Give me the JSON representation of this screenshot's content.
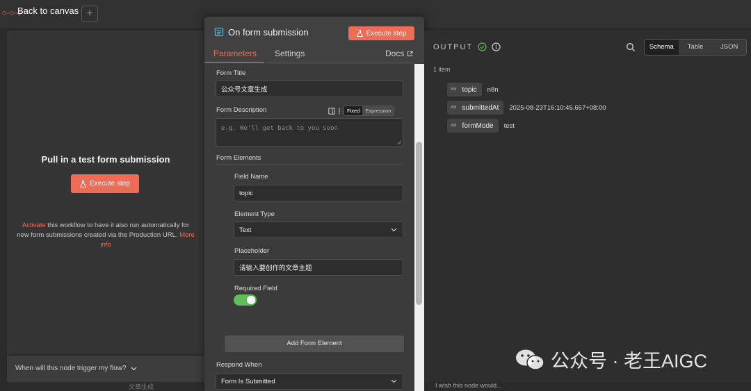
{
  "topbar": {
    "back_label": "Back to canvas",
    "add_label": "+"
  },
  "left_panel": {
    "title": "Pull in a test form submission",
    "execute_label": "Execute step",
    "desc_link_activate": "Activate",
    "desc_middle": " this workflow to have it also run automatically for new form submissions created via the Production URL. ",
    "desc_link_more": "More info",
    "footer_label": "When will this node trigger my flow?",
    "bottom_strip": "文章生成"
  },
  "node": {
    "title": "On form submission",
    "execute_label": "Execute step",
    "tabs": {
      "parameters": "Parameters",
      "settings": "Settings",
      "docs": "Docs"
    },
    "form_title_label": "Form Title",
    "form_title_value": "公众号文章生成",
    "form_desc_label": "Form Description",
    "form_desc_placeholder": "e.g. We'll get back to you soon",
    "mode_fixed": "Fixed",
    "mode_expression": "Expression",
    "form_elements_label": "Form Elements",
    "field_name_label": "Field Name",
    "field_name_value": "topic",
    "element_type_label": "Element Type",
    "element_type_value": "Text",
    "placeholder_label": "Placeholder",
    "placeholder_value": "请输入要创作的文章主题",
    "required_label": "Required Field",
    "required_on": true,
    "add_element_label": "Add Form Element",
    "respond_when_label": "Respond When",
    "respond_when_value": "Form Is Submitted"
  },
  "output": {
    "title": "OUTPUT",
    "views": [
      "Schema",
      "Table",
      "JSON"
    ],
    "active_view": "Schema",
    "item_count": "1 item",
    "fields": [
      {
        "type": "AB",
        "key": "topic",
        "value": "n8n"
      },
      {
        "type": "AB",
        "key": "submittedAt",
        "value": "2025-08-23T16:10:45.657+08:00"
      },
      {
        "type": "AB",
        "key": "formMode",
        "value": "test"
      }
    ],
    "bottom_text": "I wish this node would..."
  },
  "watermark": {
    "text": "公众号 · 老王AIGC"
  },
  "colors": {
    "accent": "#ee6b55",
    "toggle_on": "#5fbd5a",
    "success": "#5fbd5a"
  }
}
